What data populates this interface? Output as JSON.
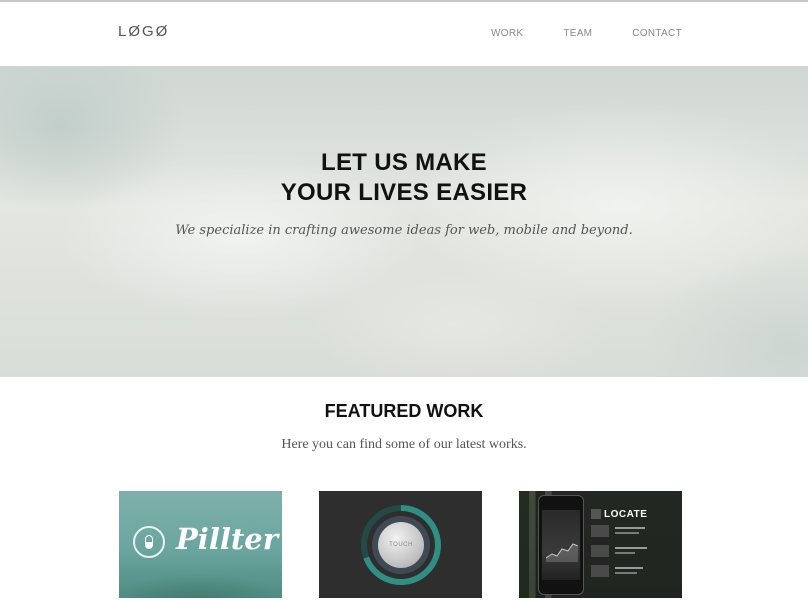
{
  "header": {
    "logo": "LØGØ",
    "nav": [
      "WORK",
      "TEAM",
      "CONTACT"
    ]
  },
  "hero": {
    "title_line1": "LET US MAKE",
    "title_line2": "YOUR LIVES EASIER",
    "subtitle": "We specialize in crafting awesome ideas for web, mobile and beyond."
  },
  "featured": {
    "title": "FEATURED WORK",
    "subtitle": "Here you can find some of our latest works.",
    "items": [
      {
        "name": "Pillter",
        "icon": "capsule-icon"
      },
      {
        "name": "TOUCH",
        "icon": "dial-icon"
      },
      {
        "name": "LOCATE",
        "icon": "phone-icon"
      }
    ]
  },
  "colors": {
    "accent": "#2f8f83",
    "pillter_bg": "#6aa59f",
    "touch_bg": "#2e2e2e"
  }
}
